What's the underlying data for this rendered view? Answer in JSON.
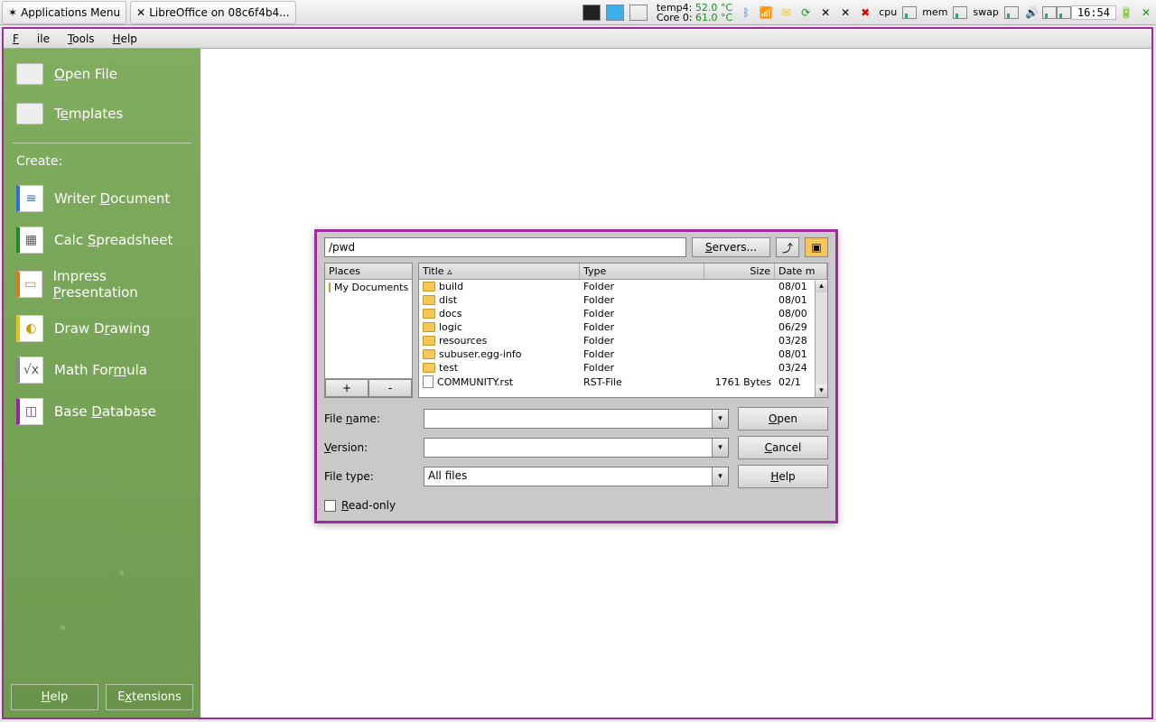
{
  "panel": {
    "appmenu": "Applications Menu",
    "task": "LibreOffice on 08c6f4b4...",
    "temps": {
      "l1a": "temp4:",
      "l1b": "52.0 °C",
      "l2a": "Core 0:",
      "l2b": "61.0 °C"
    },
    "cpu": "cpu",
    "mem": "mem",
    "swap": "swap",
    "clock": "16:54"
  },
  "menubar": {
    "file": "File",
    "tools": "Tools",
    "help": "Help"
  },
  "sidebar": {
    "open": "Open File",
    "templates": "Templates",
    "create": "Create:",
    "writer": "Writer Document",
    "calc": "Calc Spreadsheet",
    "impress": "Impress Presentation",
    "draw": "Draw Drawing",
    "math": "Math Formula",
    "base": "Base Database",
    "help": "Help",
    "ext": "Extensions"
  },
  "dialog": {
    "path": "/pwd",
    "servers": "Servers...",
    "places_hdr": "Places",
    "places_item": "My Documents",
    "cols": {
      "title": "Title ▵",
      "type": "Type",
      "size": "Size",
      "date": "Date m"
    },
    "rows": [
      {
        "name": "build",
        "type": "Folder",
        "size": "",
        "date": "08/01",
        "icon": "folder"
      },
      {
        "name": "dist",
        "type": "Folder",
        "size": "",
        "date": "08/01",
        "icon": "folder"
      },
      {
        "name": "docs",
        "type": "Folder",
        "size": "",
        "date": "08/00",
        "icon": "folder"
      },
      {
        "name": "logic",
        "type": "Folder",
        "size": "",
        "date": "06/29",
        "icon": "folder"
      },
      {
        "name": "resources",
        "type": "Folder",
        "size": "",
        "date": "03/28",
        "icon": "folder"
      },
      {
        "name": "subuser.egg-info",
        "type": "Folder",
        "size": "",
        "date": "08/01",
        "icon": "folder"
      },
      {
        "name": "test",
        "type": "Folder",
        "size": "",
        "date": "03/24",
        "icon": "folder"
      },
      {
        "name": "COMMUNITY.rst",
        "type": "RST-File",
        "size": "1761 Bytes",
        "date": "02/1",
        "icon": "doc"
      }
    ],
    "filename_lbl": "File name:",
    "version_lbl": "Version:",
    "filetype_lbl": "File type:",
    "filetype_val": "All files",
    "open": "Open",
    "cancel": "Cancel",
    "help": "Help",
    "readonly": "Read-only",
    "plus": "+",
    "minus": "-"
  }
}
